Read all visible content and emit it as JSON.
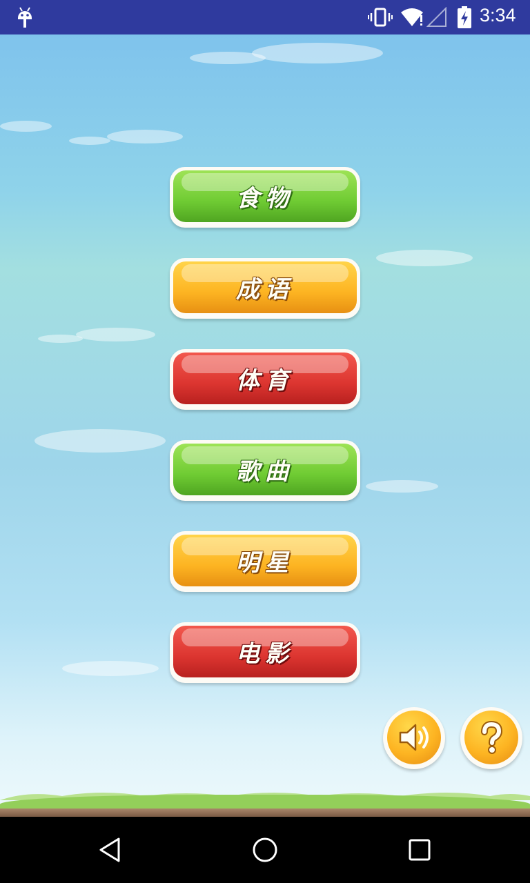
{
  "status_bar": {
    "time": "3:34",
    "icons": [
      "android-debug-icon",
      "vibrate-icon",
      "wifi-icon",
      "signal-icon",
      "battery-charging-icon"
    ]
  },
  "categories": [
    {
      "label": "食物",
      "color": "green"
    },
    {
      "label": "成语",
      "color": "orange"
    },
    {
      "label": "体育",
      "color": "red"
    },
    {
      "label": "歌曲",
      "color": "green"
    },
    {
      "label": "明星",
      "color": "orange"
    },
    {
      "label": "电影",
      "color": "red"
    }
  ],
  "controls": {
    "sound_icon": "speaker-icon",
    "help_icon": "question-mark-icon"
  },
  "nav_bar": {
    "icons": [
      "back-icon",
      "home-icon",
      "recents-icon"
    ]
  },
  "colors": {
    "status_bar": "#2f3a9e",
    "green": "#6fcb33",
    "orange": "#fdb422",
    "red": "#dc3530"
  }
}
